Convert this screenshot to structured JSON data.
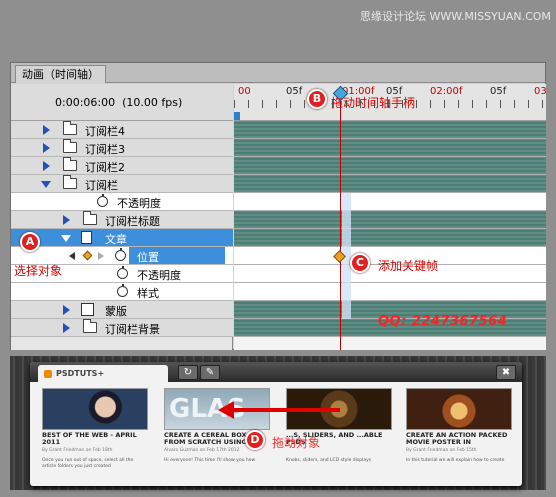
{
  "watermark": "思缘设计论坛 WWW.MISSYUAN.COM",
  "panel": {
    "title": "动画（时间轴）",
    "time": "0:00:06:00",
    "fps": "(10.00 fps)"
  },
  "ruler": {
    "labels": [
      "00",
      "05f",
      "01:00f",
      "05f",
      "02:00f",
      "05f",
      "03"
    ],
    "current_label": "01:00f"
  },
  "layers": [
    {
      "label": "订阅栏4",
      "kind": "group",
      "expanded": false
    },
    {
      "label": "订阅栏3",
      "kind": "group",
      "expanded": false
    },
    {
      "label": "订阅栏2",
      "kind": "group",
      "expanded": false
    },
    {
      "label": "订阅栏",
      "kind": "group",
      "expanded": true
    },
    {
      "label": "不透明度",
      "kind": "property"
    },
    {
      "label": "订阅栏标题",
      "kind": "group",
      "expanded": false
    },
    {
      "label": "文章",
      "kind": "layer",
      "selected": true
    },
    {
      "label": "位置",
      "kind": "property",
      "keyed": true
    },
    {
      "label": "不透明度",
      "kind": "property"
    },
    {
      "label": "样式",
      "kind": "property"
    },
    {
      "label": "蒙版",
      "kind": "layer"
    },
    {
      "label": "订阅栏背景",
      "kind": "group",
      "expanded": false
    }
  ],
  "annotations": {
    "a_badge": "A",
    "a_text": "选择对象",
    "b_badge": "B",
    "b_text": "拖动时间轴手柄",
    "c_badge": "C",
    "c_text": "添加关键帧",
    "d_badge": "D",
    "d_text": "拖动对象",
    "qq": "QQ: 2247367564"
  },
  "widget": {
    "tab_label": "PSDTUTS+",
    "refresh_icon": "↻",
    "settings_icon": "✎",
    "close_icon": "✖",
    "cards": [
      {
        "title": "BEST OF THE WEB - APRIL 2011",
        "meta": "By Grant Friedman on Feb 18th",
        "body": "Once you run out of space, select all the article folders you just created"
      },
      {
        "title": "CREATE A CEREAL BOX C... FROM SCRATCH USING",
        "meta": "Alvaro Guzman on Feb 17th 2012",
        "body": "Hi everyone! This time I'll show you how"
      },
      {
        "title": "...S, SLIDERS, AND ...ABLE PSDS",
        "meta": "",
        "body": "Knobs, sliders, and LCD style displays"
      },
      {
        "title": "CREATE AN ACTION PACKED MOVIE POSTER IN",
        "meta": "By Grant Friedman on Feb 15th",
        "body": "In this tutorial we will explain how to create"
      }
    ],
    "card2_image_text": "GLAS"
  }
}
